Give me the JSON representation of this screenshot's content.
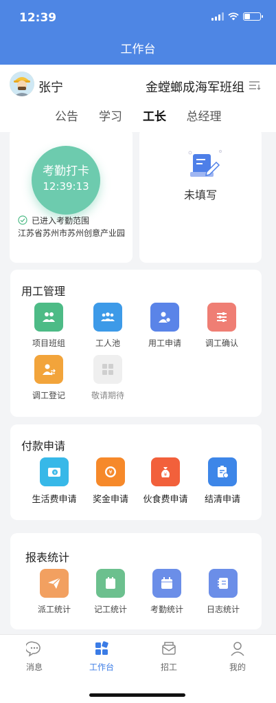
{
  "status": {
    "time": "12:39"
  },
  "nav": {
    "title": "工作台"
  },
  "header": {
    "user_name": "张宁",
    "team_name": "金螳螂成海军班组",
    "tabs": [
      {
        "label": "公告"
      },
      {
        "label": "学习"
      },
      {
        "label": "工长",
        "active": true
      },
      {
        "label": "总经理"
      }
    ]
  },
  "attendance": {
    "button_label": "考勤打卡",
    "time": "12:39:13",
    "range_status": "已进入考勤范围",
    "address": "江苏省苏州市苏州创意产业园"
  },
  "form_card": {
    "status": "未填写"
  },
  "labor": {
    "title": "用工管理",
    "items": [
      {
        "label": "项目班组",
        "icon": "team-icon",
        "color": "#4dbb86"
      },
      {
        "label": "工人池",
        "icon": "workers-icon",
        "color": "#3d9ae8"
      },
      {
        "label": "用工申请",
        "icon": "person-apply-icon",
        "color": "#5a84e8"
      },
      {
        "label": "调工确认",
        "icon": "sliders-icon",
        "color": "#ef7e74"
      },
      {
        "label": "调工登记",
        "icon": "person-transfer-icon",
        "color": "#f2a43b"
      },
      {
        "label": "敬请期待",
        "icon": "grid-placeholder-icon",
        "color": "#efefef"
      }
    ]
  },
  "payment": {
    "title": "付款申请",
    "items": [
      {
        "label": "生活费申请",
        "icon": "wallet-icon",
        "color": "#37b8e8"
      },
      {
        "label": "奖金申请",
        "icon": "coin-icon",
        "color": "#f6892a"
      },
      {
        "label": "伙食费申请",
        "icon": "money-bag-icon",
        "color": "#f2603b"
      },
      {
        "label": "结清申请",
        "icon": "clipboard-money-icon",
        "color": "#3d86e8"
      }
    ]
  },
  "reports": {
    "title": "报表统计",
    "items": [
      {
        "label": "派工统计",
        "icon": "send-icon",
        "color": "#f2a060"
      },
      {
        "label": "记工统计",
        "icon": "notebook-icon",
        "color": "#6cc08e"
      },
      {
        "label": "考勤统计",
        "icon": "calendar-icon",
        "color": "#6b8ee8"
      },
      {
        "label": "日志统计",
        "icon": "log-book-icon",
        "color": "#6b8ee8"
      }
    ]
  },
  "tabbar": {
    "items": [
      {
        "label": "消息"
      },
      {
        "label": "工作台",
        "active": true
      },
      {
        "label": "招工"
      },
      {
        "label": "我的"
      }
    ]
  }
}
